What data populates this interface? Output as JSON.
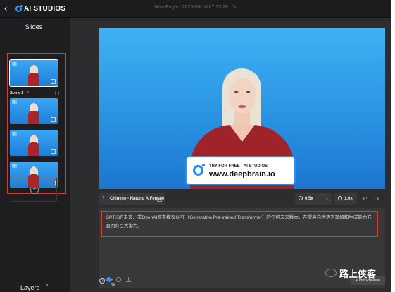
{
  "header": {
    "back_icon": "chevron-left-icon",
    "app_name": "AI STUDIOS",
    "project_title": "New Project 2023-08-10 07:33:28",
    "edit_icon": "edit-icon"
  },
  "sidebar": {
    "title": "Slides",
    "scene_label": "Scene 1",
    "slide_numbers": [
      "1",
      "2",
      "3",
      "4"
    ],
    "layers_label": "Layers",
    "layers_caret": "^"
  },
  "canvas": {
    "badge_line1": "TRY FOR FREE : AI STUDIOS",
    "badge_line2": "www.deepbrain.io"
  },
  "toolbar": {
    "voice_label": "Chinese - Natural A Female",
    "speed_value": "0.5x",
    "pitch_value": "1.0x",
    "undo_icon": "undo-icon",
    "redo_icon": "redo-icon"
  },
  "script": {
    "text": "GPT-5的未来，或OpenAI原有模型GPT（Generative Pre-trained Transformer）的任何未来版本，在提高自然语言理解和生成能力方面拥有巨大潜力。"
  },
  "bottom": {
    "help": "?",
    "progress_text": "5 %",
    "audio_preview_label": "Audio Preview",
    "watermark_text": "路上侠客"
  },
  "colors": {
    "accent": "#2f9bff",
    "highlight": "#d53b35",
    "background": "#2d2d2f"
  }
}
